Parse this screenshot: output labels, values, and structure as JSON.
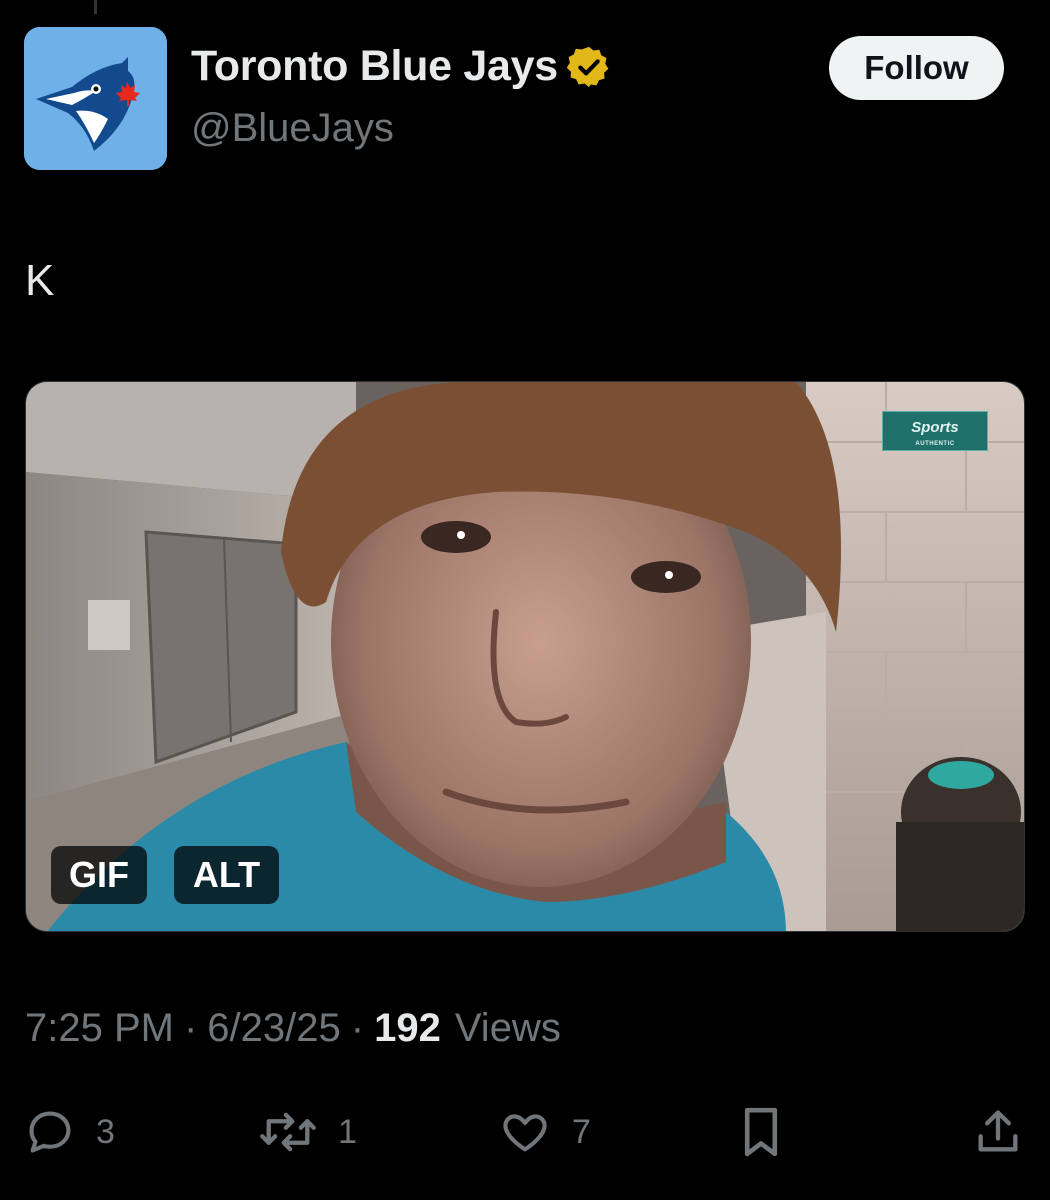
{
  "account": {
    "display_name": "Toronto Blue Jays",
    "handle": "@BlueJays",
    "verified_icon": "verified-badge-icon",
    "avatar_color": "#6fb0e8"
  },
  "follow_button": {
    "label": "Follow"
  },
  "tweet": {
    "text": "K"
  },
  "media": {
    "gif_label": "GIF",
    "alt_label": "ALT",
    "watermark": "Sports",
    "watermark_sub": "AUTHENTIC"
  },
  "meta": {
    "time": "7:25 PM",
    "separator": "·",
    "date": "6/23/25",
    "views_count": "192",
    "views_label": "Views"
  },
  "actions": {
    "replies": "3",
    "reposts": "1",
    "likes": "7"
  },
  "colors": {
    "background": "#000000",
    "primary_text": "#e7e9ea",
    "secondary_text": "#71767b",
    "verified_gold": "#e2b719"
  }
}
